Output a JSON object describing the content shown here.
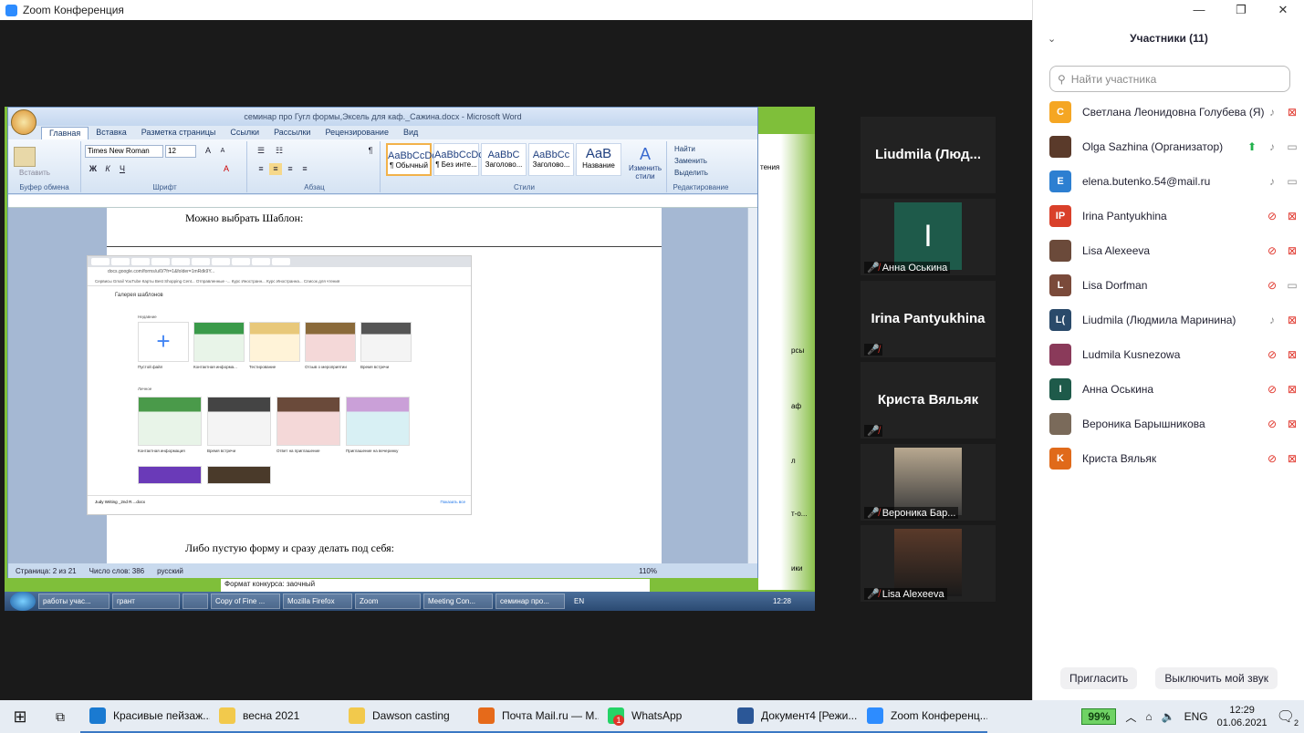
{
  "app": {
    "title": "Zoom Конференция"
  },
  "share": {
    "word": {
      "title": "семинар про Гугл формы,Эксель для каф._Сажина.docx - Microsoft Word",
      "tabs": [
        "Главная",
        "Вставка",
        "Разметка страницы",
        "Ссылки",
        "Рассылки",
        "Рецензирование",
        "Вид"
      ],
      "active_tab": "Главная",
      "groups": {
        "clipboard": "Буфер обмена",
        "font": "Шрифт",
        "paragraph": "Абзац",
        "styles": "Стили",
        "editing": "Редактирование"
      },
      "paste_label": "Вставить",
      "font_name": "Times New Roman",
      "font_size": "12",
      "styles": [
        {
          "sample": "AaBbCcDc",
          "name": "¶ Обычный"
        },
        {
          "sample": "AaBbCcDc",
          "name": "¶ Без инте..."
        },
        {
          "sample": "AaBbC",
          "name": "Заголово..."
        },
        {
          "sample": "AaBbCc",
          "name": "Заголово..."
        },
        {
          "sample": "AaB",
          "name": "Название"
        }
      ],
      "change_styles": "Изменить стили",
      "editing_items": [
        "Найти",
        "Заменить",
        "Выделить"
      ],
      "doc_text_top": "Можно выбрать Шаблон:",
      "doc_text_bottom": "Либо пустую форму и сразу делать под себя:",
      "status": {
        "page": "Страница: 2 из 21",
        "words": "Число слов: 386",
        "lang": "русский",
        "zoom": "110%"
      }
    },
    "embedded": {
      "gallery_title": "Галерея шаблонов",
      "section_recent": "Недавние",
      "section_personal": "Личное",
      "row1": [
        "Пустой файл",
        "Контактная информа...",
        "Тестирование",
        "Отзыв о мероприятии",
        "Время встречи"
      ],
      "row2": [
        "Контактная информация",
        "Время встречи",
        "Ответ на приглашение",
        "Приглашение на вечеринку"
      ],
      "url": "docs.google.com/forms/u/0/?fr=1&folder=1mRdk9Y...",
      "bookmarks": "Сервисы  Gmail  YouTube  Карты  Best Shopping Cent...  Отправленные -...  Курс Иностранн...  Курс Иностранна...  Список для чтения",
      "download_item": "Judy Writing _2nd R....docx",
      "download_btn": "Показать все",
      "below_text": "Формат конкурса: заочный"
    },
    "inner_taskbar": {
      "items": [
        "работы учас...",
        "грант",
        "",
        "Copy of Fine ...",
        "Mozilla Firefox",
        "Zoom",
        "Meeting Con...",
        "семинар про..."
      ],
      "lang": "EN",
      "time": "12:28"
    },
    "side_fragments": [
      "тения",
      "рсы",
      "аф",
      "л",
      "т-о...",
      "ики"
    ]
  },
  "gallery_tiles": [
    {
      "name": "Liudmila  (Люд...",
      "label": ""
    },
    {
      "name": "",
      "label": "Анна Оськина",
      "avatar_letter": "I"
    },
    {
      "name": "Irina Pantyukhina",
      "label": ""
    },
    {
      "name": "Криста Вяльяк",
      "label": ""
    },
    {
      "name": "",
      "label": "Вероника Бар..."
    },
    {
      "name": "",
      "label": "Lisa Alexeeva"
    }
  ],
  "panel": {
    "title": "Участники (11)",
    "search_placeholder": "Найти участника",
    "participants": [
      {
        "initials": "С",
        "color": "#f5a623",
        "name": "Светлана Леонидовна Голубева (Я)",
        "mic": "on",
        "video": "off"
      },
      {
        "initials": "",
        "color": "#5a3a2a",
        "name": "Olga Sazhina (Организатор)",
        "mic": "on",
        "video": "on",
        "share": true
      },
      {
        "initials": "E",
        "color": "#2d7fd1",
        "name": "elena.butenko.54@mail.ru",
        "mic": "on",
        "video": "on"
      },
      {
        "initials": "IP",
        "color": "#d9402a",
        "name": "Irina Pantyukhina",
        "mic": "off",
        "video": "off"
      },
      {
        "initials": "",
        "color": "#6b4a3a",
        "name": "Lisa Alexeeva",
        "mic": "off",
        "video": "off"
      },
      {
        "initials": "L",
        "color": "#7a4a3a",
        "name": "Lisa Dorfman",
        "mic": "off",
        "video": "on"
      },
      {
        "initials": "L(",
        "color": "#2a4a6a",
        "name": "Liudmila (Людмила Маринина)",
        "mic": "on",
        "video": "off"
      },
      {
        "initials": "",
        "color": "#8a3a5a",
        "name": "Ludmila Kusnezowa",
        "mic": "off",
        "video": "off"
      },
      {
        "initials": "I",
        "color": "#1e5a4a",
        "name": "Анна Оськина",
        "mic": "off",
        "video": "off"
      },
      {
        "initials": "",
        "color": "#7a6a5a",
        "name": "Вероника Барышникова",
        "mic": "off",
        "video": "off"
      },
      {
        "initials": "K",
        "color": "#e06a1a",
        "name": "Криста Вяльяк",
        "mic": "off",
        "video": "off"
      }
    ],
    "invite": "Пригласить",
    "unmute": "Выключить мой звук"
  },
  "taskbar": {
    "items": [
      {
        "label": "Красивые пейзаж...",
        "color": "#1a7ad1"
      },
      {
        "label": "весна 2021",
        "color": "#f2c94c"
      },
      {
        "label": "Dawson casting",
        "color": "#f2c94c"
      },
      {
        "label": "Почта Mail.ru — M...",
        "color": "#e66a1a"
      },
      {
        "label": "WhatsApp",
        "color": "#25d366",
        "badge": "1"
      },
      {
        "label": "Документ4 [Режи...",
        "color": "#2b5797"
      },
      {
        "label": "Zoom Конференц...",
        "color": "#2d8cff"
      }
    ],
    "battery": "99%",
    "lang": "ENG",
    "time": "12:29",
    "date": "01.06.2021",
    "notif": "2"
  }
}
